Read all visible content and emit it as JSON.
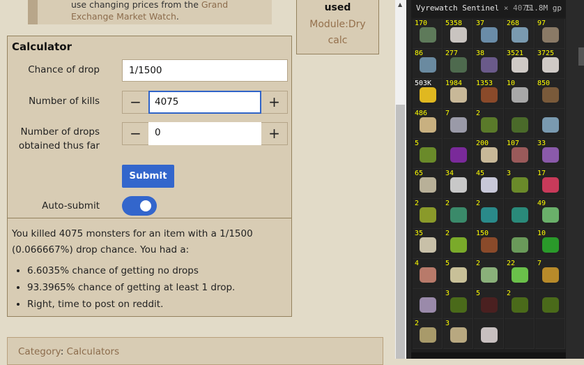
{
  "note": {
    "text_prefix": "use changing prices from the ",
    "link": "Grand Exchange",
    "text_line2_link": "Market Watch",
    "suffix": "."
  },
  "side_box": {
    "title": "used",
    "module_line1": "Module:Dry",
    "module_line2": "calc"
  },
  "calculator": {
    "title": "Calculator",
    "chance_label": "Chance of drop",
    "chance_value": "1/1500",
    "kills_label": "Number of kills",
    "kills_value": "4075",
    "drops_label_1": "Number of drops",
    "drops_label_2": "obtained thus far",
    "drops_value": "0",
    "minus": "−",
    "plus": "+",
    "submit_label": "Submit",
    "autosubmit_label": "Auto-submit",
    "autosubmit_on": true,
    "result_line1": "You killed 4075 monsters for an item with a 1/1500",
    "result_line2": "(0.066667%) drop chance. You had a:",
    "bullets": [
      "6.6035% chance of getting no drops",
      "93.3965% chance of getting at least 1 drop.",
      "Right, time to post on reddit."
    ]
  },
  "category": {
    "label": "Category",
    "value": "Calculators"
  },
  "loot_tracker": {
    "title": "Vyrewatch Sentinel",
    "kills": "× 4075",
    "total": "11.8M gp",
    "items": [
      {
        "qty": "170",
        "color": "#5e7a5a"
      },
      {
        "qty": "5358",
        "color": "#c9c4c0"
      },
      {
        "qty": "37",
        "color": "#6a8ca8"
      },
      {
        "qty": "268",
        "color": "#7a9ab0"
      },
      {
        "qty": "97",
        "color": "#8a7a66"
      },
      {
        "qty": "86",
        "color": "#6a8aa0"
      },
      {
        "qty": "277",
        "color": "#4e6a4e"
      },
      {
        "qty": "38",
        "color": "#6a5a8a"
      },
      {
        "qty": "3521",
        "color": "#cfcac6"
      },
      {
        "qty": "3725",
        "color": "#cfcac6"
      },
      {
        "qty": "503K",
        "color": "#e0b820",
        "white": true
      },
      {
        "qty": "1984",
        "color": "#c8b898"
      },
      {
        "qty": "1353",
        "color": "#8a4a2a"
      },
      {
        "qty": "10",
        "color": "#a8a8a8"
      },
      {
        "qty": "850",
        "color": "#7a5a3a"
      },
      {
        "qty": "486",
        "color": "#c8b080"
      },
      {
        "qty": "7",
        "color": "#9a9aa8"
      },
      {
        "qty": "2",
        "color": "#5a7a2a"
      },
      {
        "qty": "",
        "color": "#4a6a2a"
      },
      {
        "qty": "",
        "color": "#7a9ab0"
      },
      {
        "qty": "5",
        "color": "#6a8a2a"
      },
      {
        "qty": "",
        "color": "#7a2a9a"
      },
      {
        "qty": "200",
        "color": "#c8b898"
      },
      {
        "qty": "107",
        "color": "#9a5a5a"
      },
      {
        "qty": "33",
        "color": "#8a5aaa"
      },
      {
        "qty": "65",
        "color": "#b8b098"
      },
      {
        "qty": "34",
        "color": "#c8c8c8"
      },
      {
        "qty": "45",
        "color": "#c8c8d8"
      },
      {
        "qty": "3",
        "color": "#6a8a2a"
      },
      {
        "qty": "17",
        "color": "#c83a5a"
      },
      {
        "qty": "2",
        "color": "#8a9a2a"
      },
      {
        "qty": "2",
        "color": "#3a8a6a"
      },
      {
        "qty": "2",
        "color": "#2a8a8a"
      },
      {
        "qty": "",
        "color": "#2a8a7a"
      },
      {
        "qty": "49",
        "color": "#6ab06a"
      },
      {
        "qty": "35",
        "color": "#c8c0a8"
      },
      {
        "qty": "2",
        "color": "#7aaa2a"
      },
      {
        "qty": "150",
        "color": "#8a4a2a"
      },
      {
        "qty": "",
        "color": "#6a9a5a"
      },
      {
        "qty": "10",
        "color": "#2a9a2a"
      },
      {
        "qty": "4",
        "color": "#b87a6a"
      },
      {
        "qty": "5",
        "color": "#c8c098"
      },
      {
        "qty": "2",
        "color": "#8ab07a"
      },
      {
        "qty": "22",
        "color": "#6ac04a"
      },
      {
        "qty": "7",
        "color": "#b88a2a"
      },
      {
        "qty": "",
        "color": "#9a8aaa"
      },
      {
        "qty": "3",
        "color": "#4a6a1a"
      },
      {
        "qty": "5",
        "color": "#4a2020"
      },
      {
        "qty": "2",
        "color": "#4a6a1a"
      },
      {
        "qty": "",
        "color": "#4a6a1a"
      },
      {
        "qty": "2",
        "color": "#a89a6a"
      },
      {
        "qty": "3",
        "color": "#b8a880"
      },
      {
        "qty": "",
        "color": "#c8c0c0"
      },
      {
        "qty": "",
        "color": ""
      },
      {
        "qty": "",
        "color": ""
      }
    ]
  }
}
